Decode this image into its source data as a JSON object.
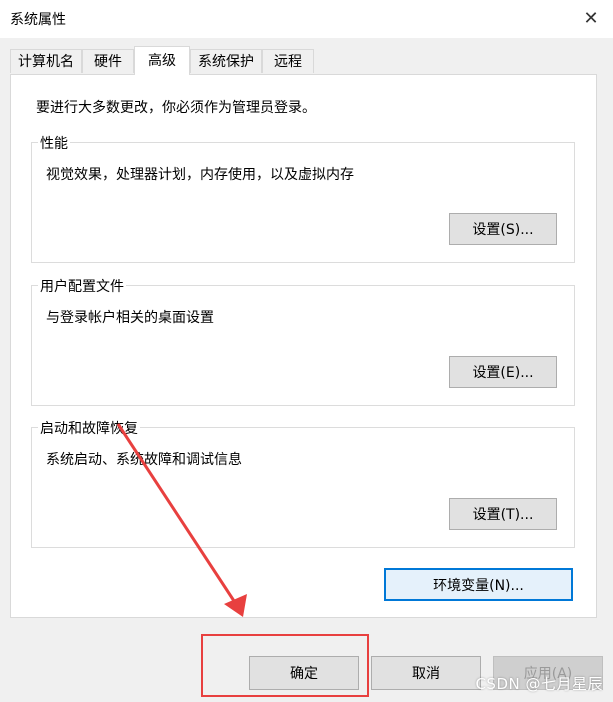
{
  "window": {
    "title": "系统属性",
    "close_glyph": "✕"
  },
  "tabs": [
    {
      "label": "计算机名"
    },
    {
      "label": "硬件"
    },
    {
      "label": "高级",
      "active": true
    },
    {
      "label": "系统保护"
    },
    {
      "label": "远程"
    }
  ],
  "notice": "要进行大多数更改，你必须作为管理员登录。",
  "performance": {
    "legend": "性能",
    "desc": "视觉效果，处理器计划，内存使用，以及虚拟内存",
    "button": "设置(S)..."
  },
  "user_profiles": {
    "legend": "用户配置文件",
    "desc": "与登录帐户相关的桌面设置",
    "button": "设置(E)..."
  },
  "startup": {
    "legend": "启动和故障恢复",
    "desc": "系统启动、系统故障和调试信息",
    "button": "设置(T)..."
  },
  "env_button": "环境变量(N)...",
  "footer": {
    "ok": "确定",
    "cancel": "取消",
    "apply": "应用(A)"
  },
  "annotation": {
    "color": "#e8403f"
  },
  "watermark": "CSDN @七月星辰",
  "colors": {
    "focus": "#0078d7",
    "button": "#e1e1e1",
    "background": "#f0f0f0"
  }
}
